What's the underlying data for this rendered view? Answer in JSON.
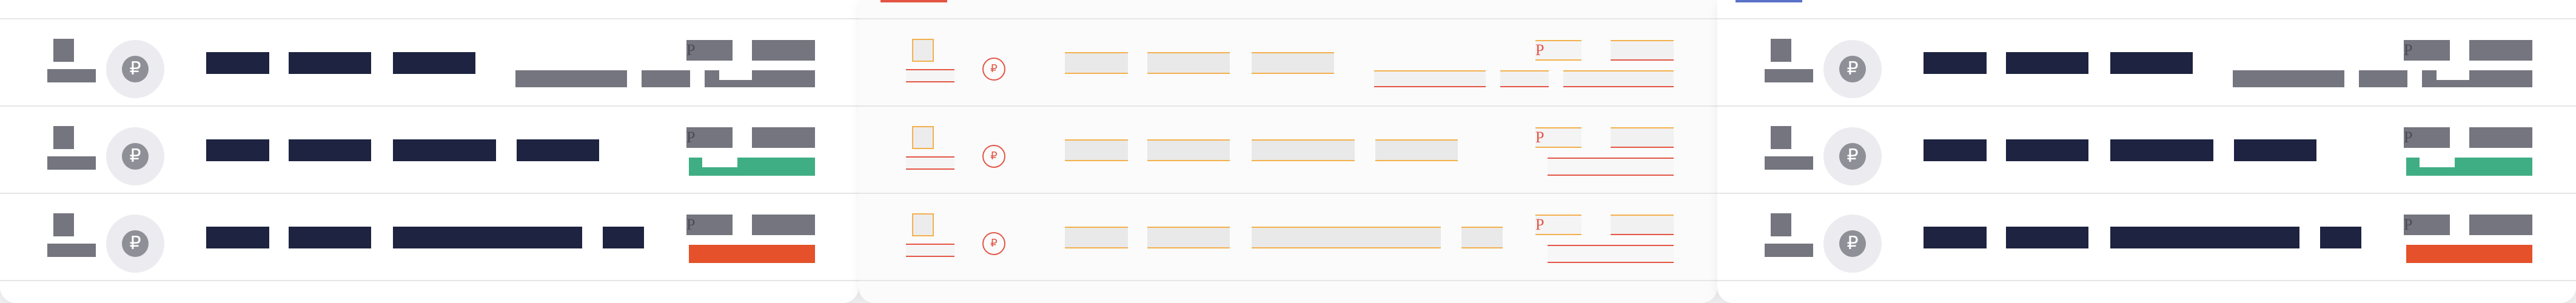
{
  "currency_symbol": "₽",
  "price_prefix": "P",
  "colors": {
    "dark_text": "#1d2340",
    "muted": "#74757e",
    "status_green": "#3fae84",
    "status_red": "#e4512a",
    "accent_orange": "#f4b04e",
    "accent_red": "#e45545",
    "accent_blue": "#5a73c9"
  },
  "panels": [
    {
      "name": "left",
      "rows": [
        {
          "status": "neutral"
        },
        {
          "status": "green"
        },
        {
          "status": "red"
        }
      ]
    },
    {
      "name": "middle",
      "rows": [
        {
          "status": "placeholder"
        },
        {
          "status": "placeholder"
        },
        {
          "status": "placeholder"
        }
      ]
    },
    {
      "name": "right",
      "rows": [
        {
          "status": "neutral"
        },
        {
          "status": "green"
        },
        {
          "status": "red"
        }
      ]
    }
  ]
}
